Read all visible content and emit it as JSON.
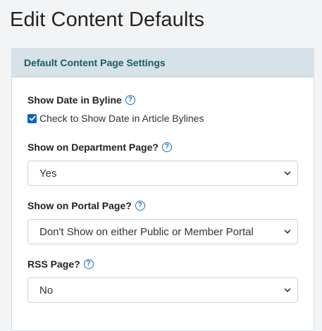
{
  "page": {
    "title": "Edit Content Defaults"
  },
  "card": {
    "header": "Default Content Page Settings"
  },
  "fields": {
    "show_date": {
      "label": "Show Date in Byline",
      "help": "?",
      "checkbox_label": "Check to Show Date in Article Bylines",
      "checked": true
    },
    "department_page": {
      "label": "Show on Department Page?",
      "help": "?",
      "value": "Yes"
    },
    "portal_page": {
      "label": "Show on Portal Page?",
      "help": "?",
      "value": "Don't Show on either Public or Member Portal"
    },
    "rss_page": {
      "label": "RSS Page?",
      "help": "?",
      "value": "No"
    }
  },
  "colors": {
    "header_bg": "#d6e2e7",
    "header_text": "#1e5866",
    "help_icon": "#1a73b8",
    "checkbox": "#0b62c4"
  },
  "icons": {
    "help": "question-circle-icon",
    "select_arrow": "chevron-down-icon",
    "check": "checkmark-icon"
  }
}
